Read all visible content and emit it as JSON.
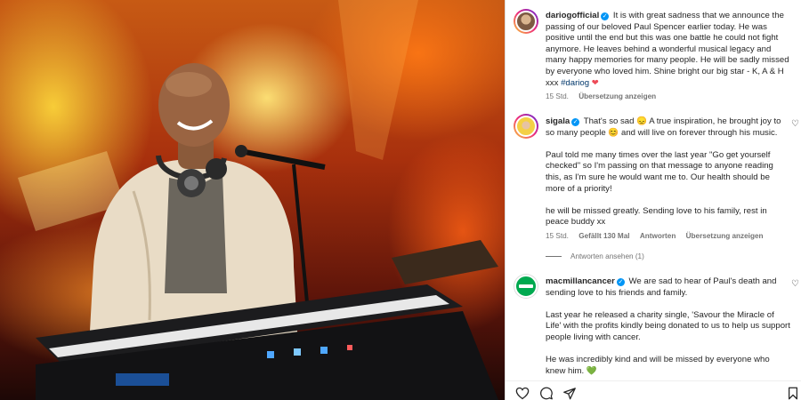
{
  "post": {
    "username": "dariogofficial",
    "caption": "It is with great sadness that we announce the passing of our beloved Paul Spencer earlier today. He was positive until the end but this was one battle he could not fight anymore. He leaves behind a wonderful musical legacy and many happy memories for many people. He will be sadly missed by everyone who loved him. Shine bright our big star - K, A & H xxx",
    "hashtag": "#dariog",
    "heart": "❤",
    "time": "15 Std.",
    "translate": "Übersetzung anzeigen"
  },
  "comments": [
    {
      "username": "sigala",
      "paragraphs": [
        "That's so sad 😞 A true inspiration, he brought joy to so many people 😊 and will live on forever through his music.",
        "Paul told me many times over the last year \"Go get yourself checked\" so I'm passing on that message to anyone reading this, as I'm sure he would want me to. Our health should be more of a priority!",
        "he will be missed greatly. Sending love to his family, rest in peace buddy xx"
      ],
      "time": "15 Std.",
      "likes": "Gefällt 130 Mal",
      "reply": "Antworten",
      "translate": "Übersetzung anzeigen",
      "view_replies": "Antworten ansehen (1)"
    },
    {
      "username": "macmillancancer",
      "paragraphs": [
        "We are sad to hear of Paul's death and sending love to his friends and family.",
        "Last year he released a charity single, 'Savour the Miracle of Life' with the profits kindly being donated to us to help us support people living with cancer.",
        "He was incredibly kind and will be missed by everyone who knew him."
      ],
      "end_emoji": "💚"
    }
  ],
  "icons": {
    "verified": "✓",
    "like_small": "♡"
  },
  "colors": {
    "verified": "#0095f6",
    "link": "#00376b",
    "meta": "#737373",
    "heart": "#ed4956",
    "macmillan_green": "#00a94f"
  }
}
